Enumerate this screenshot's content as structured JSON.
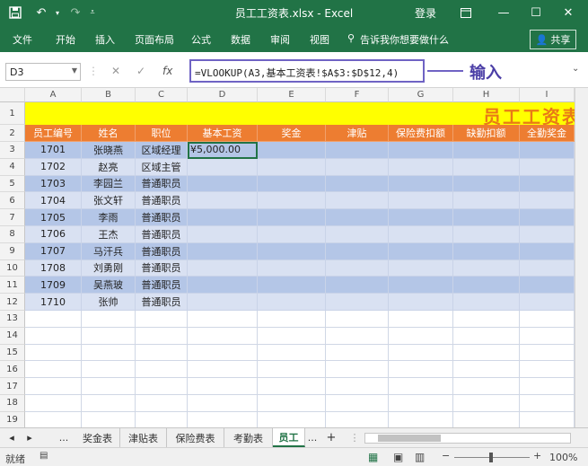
{
  "window": {
    "title": "员工工资表.xlsx - Excel",
    "login": "登录",
    "colors": {
      "accent": "#217346",
      "header_orange": "#ed7d31",
      "title_yellow": "#ffff00",
      "band_blue": "#b4c6e7",
      "band_light": "#d9e1f2",
      "callout_purple": "#6f63c4"
    }
  },
  "quick_access": {
    "icons": [
      "save-icon",
      "undo-icon",
      "redo-icon",
      "customize-icon"
    ]
  },
  "ribbon": {
    "tabs": [
      "文件",
      "开始",
      "插入",
      "页面布局",
      "公式",
      "数据",
      "审阅",
      "视图"
    ],
    "tell_me": "告诉我你想要做什么",
    "share": "共享"
  },
  "formula_bar": {
    "name_box": "D3",
    "cancel": "✕",
    "enter": "✓",
    "fx": "fx",
    "formula": "=VLOOKUP(A3,基本工资表!$A$3:$D$12,4)",
    "callout": "输入"
  },
  "sheet": {
    "columns": [
      "A",
      "B",
      "C",
      "D",
      "E",
      "F",
      "G",
      "H",
      "I"
    ],
    "row_numbers": [
      "1",
      "2",
      "3",
      "4",
      "5",
      "6",
      "7",
      "8",
      "9",
      "10",
      "11",
      "12",
      "13",
      "14",
      "15",
      "16",
      "17",
      "18",
      "19"
    ],
    "title": "员工工资表",
    "headers": [
      "员工编号",
      "姓名",
      "职位",
      "基本工资",
      "奖金",
      "津贴",
      "保险费扣额",
      "缺勤扣额",
      "全勤奖金"
    ],
    "rows": [
      [
        "1701",
        "张晓燕",
        "区域经理",
        "¥5,000.00"
      ],
      [
        "1702",
        "赵亮",
        "区域主管",
        ""
      ],
      [
        "1703",
        "李园兰",
        "普通职员",
        ""
      ],
      [
        "1704",
        "张文轩",
        "普通职员",
        ""
      ],
      [
        "1705",
        "李雨",
        "普通职员",
        ""
      ],
      [
        "1706",
        "王杰",
        "普通职员",
        ""
      ],
      [
        "1707",
        "马汗兵",
        "普通职员",
        ""
      ],
      [
        "1708",
        "刘勇刚",
        "普通职员",
        ""
      ],
      [
        "1709",
        "吴燕玻",
        "普通职员",
        ""
      ],
      [
        "1710",
        "张帅",
        "普通职员",
        ""
      ]
    ]
  },
  "sheet_tabs": {
    "ellipsis": "...",
    "tabs": [
      "奖金表",
      "津贴表",
      "保险费表",
      "考勤表",
      "员工"
    ],
    "more": "...",
    "add": "+",
    "active_index": 4
  },
  "status": {
    "ready": "就绪",
    "zoom": "100%"
  }
}
